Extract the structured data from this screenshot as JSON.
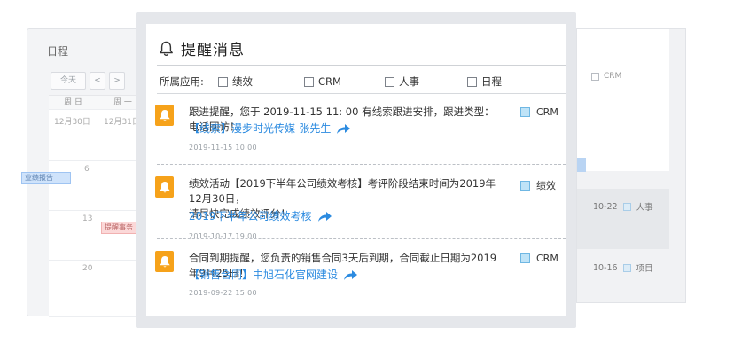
{
  "bg_calendar": {
    "title": "日程",
    "today_btn": "今天",
    "prev_btn": "<",
    "next_btn": ">",
    "weekdays": [
      "周 日",
      "周 一"
    ],
    "dates": [
      "12月30日",
      "12月31日",
      "6",
      "13",
      "20"
    ],
    "events": [
      "业绩报告",
      "提醒事务"
    ]
  },
  "bg_right": {
    "filter_crm": "CRM",
    "rows": [
      {
        "date": "10-22",
        "label": "人事"
      },
      {
        "date": "10-16",
        "label": "项目"
      }
    ]
  },
  "popup": {
    "title": "提醒消息",
    "filter_label": "所属应用:",
    "filters": [
      "绩效",
      "CRM",
      "人事",
      "日程"
    ],
    "items": [
      {
        "line1": "跟进提醒，您于 2019-11-15  11: 00 有线索跟进安排，跟进类型：电话回访！",
        "link": "【线索】漫步时光传媒-张先生",
        "time": "2019-11-15  10:00",
        "app": "CRM"
      },
      {
        "line1": "绩效活动【2019下半年公司绩效考核】考评阶段结束时间为2019年12月30日，",
        "line2": "请尽快完成绩效评分！",
        "link": "2019下半年公司绩效考核",
        "time": "2019-10-17  19:00",
        "app": "绩效"
      },
      {
        "line1": "合同到期提醒，您负责的销售合同3天后到期，合同截止日期为2019年9月25日！",
        "link": "【销售合同】中旭石化官网建设",
        "time": "2019-09-22  15:00",
        "app": "CRM"
      }
    ]
  },
  "colors": {
    "accent_orange": "#f6a21a",
    "link_blue": "#2c8be0"
  }
}
